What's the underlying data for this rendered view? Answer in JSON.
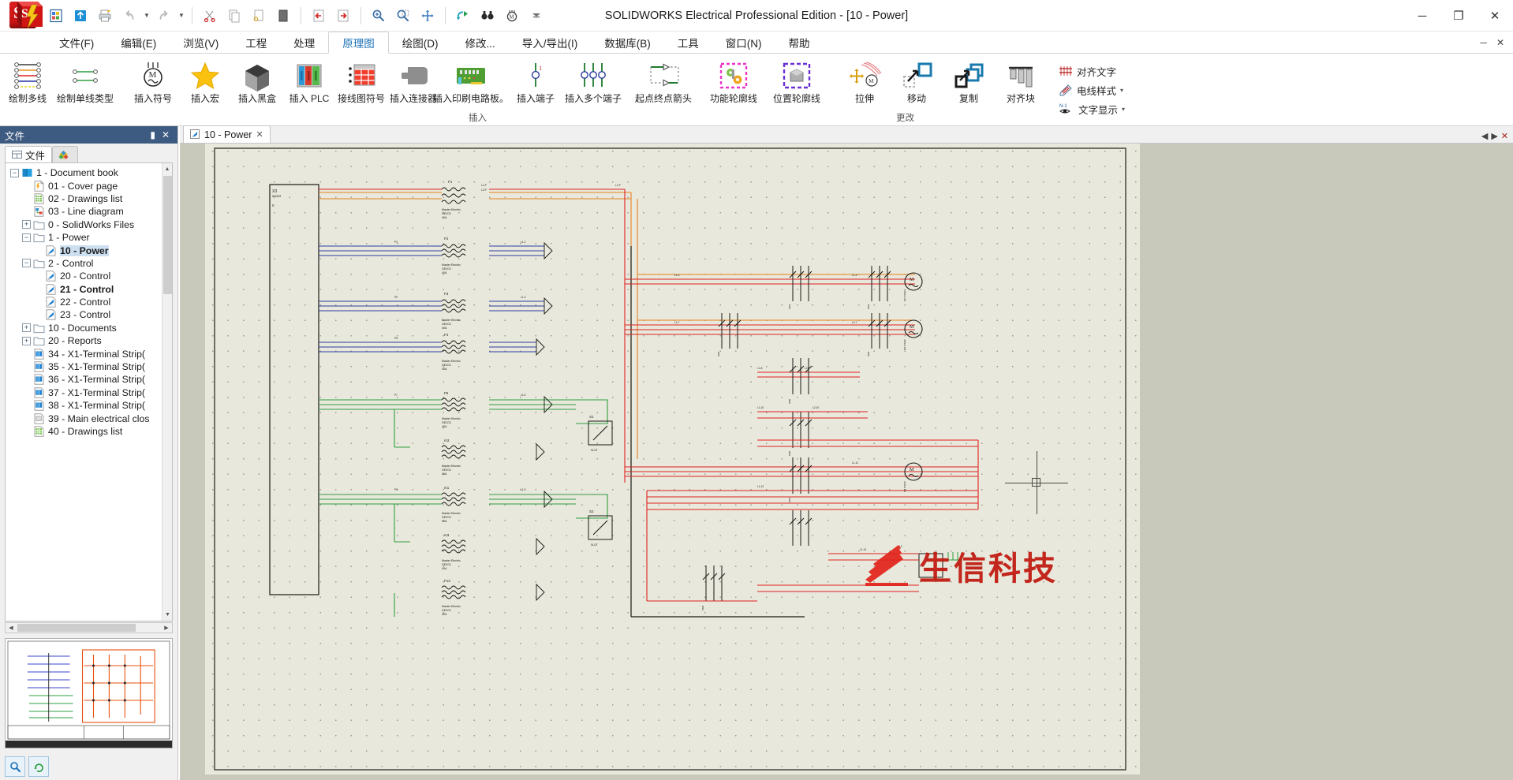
{
  "window": {
    "title": "SOLIDWORKS Electrical Professional Edition - [10 - Power]",
    "minimize_label": "─",
    "restore_label": "❐",
    "close_label": "✕"
  },
  "quick_toolbar": {
    "items": [
      {
        "name": "new-project-icon",
        "glyph": "▦"
      },
      {
        "name": "open-icon",
        "glyph": "⬆"
      },
      {
        "name": "print-icon",
        "glyph": "⎙"
      },
      {
        "name": "undo-icon",
        "glyph": "↶"
      },
      {
        "name": "undo-dropdown-icon",
        "glyph": "▾"
      },
      {
        "name": "redo-icon",
        "glyph": "↷"
      },
      {
        "name": "redo-dropdown-icon",
        "glyph": "▾"
      },
      {
        "name": "cut-icon",
        "glyph": "✂"
      },
      {
        "name": "copy-icon",
        "glyph": "❐"
      },
      {
        "name": "paste-special-icon",
        "glyph": "❑"
      },
      {
        "name": "paste-icon",
        "glyph": "▮"
      },
      {
        "name": "previous-page-icon",
        "glyph": "←"
      },
      {
        "name": "next-page-icon",
        "glyph": "→"
      },
      {
        "name": "zoom-in-icon",
        "glyph": "⌕"
      },
      {
        "name": "zoom-window-icon",
        "glyph": "⌕"
      },
      {
        "name": "pan-icon",
        "glyph": "✥"
      },
      {
        "name": "update-icon",
        "glyph": "↻"
      },
      {
        "name": "find-icon",
        "glyph": "⚭"
      },
      {
        "name": "motor-icon",
        "glyph": "Ⓜ"
      },
      {
        "name": "customize-dropdown-icon",
        "glyph": "▼"
      }
    ]
  },
  "menubar": {
    "items": [
      {
        "label": "文件(F)",
        "name": "menu-file",
        "active": false
      },
      {
        "label": "编辑(E)",
        "name": "menu-edit",
        "active": false
      },
      {
        "label": "浏览(V)",
        "name": "menu-view",
        "active": false
      },
      {
        "label": "工程",
        "name": "menu-project",
        "active": false
      },
      {
        "label": "处理",
        "name": "menu-process",
        "active": false
      },
      {
        "label": "原理图",
        "name": "menu-schematic",
        "active": true
      },
      {
        "label": "绘图(D)",
        "name": "menu-draw",
        "active": false
      },
      {
        "label": "修改...",
        "name": "menu-modify",
        "active": false
      },
      {
        "label": "导入/导出(I)",
        "name": "menu-import-export",
        "active": false
      },
      {
        "label": "数据库(B)",
        "name": "menu-database",
        "active": false
      },
      {
        "label": "工具",
        "name": "menu-tools",
        "active": false
      },
      {
        "label": "窗口(N)",
        "name": "menu-window",
        "active": false
      },
      {
        "label": "帮助",
        "name": "menu-help",
        "active": false
      }
    ],
    "minimize_ribbon": "─",
    "close_doc": "✕"
  },
  "ribbon": {
    "groups": [
      {
        "label": "",
        "name": "ribbon-group-wires",
        "buttons": [
          {
            "label": "绘制多线",
            "name": "draw-multiple-wires-button",
            "icon": "multi-wire-icon"
          },
          {
            "label": "绘制单线类型",
            "name": "draw-single-wire-type-button",
            "icon": "single-wire-icon"
          }
        ]
      },
      {
        "label": "插入",
        "name": "ribbon-group-insert",
        "buttons": [
          {
            "label": "插入符号",
            "name": "insert-symbol-button",
            "icon": "motor-symbol-icon"
          },
          {
            "label": "插入宏",
            "name": "insert-macro-button",
            "icon": "star-icon"
          },
          {
            "label": "插入黑盒",
            "name": "insert-black-box-button",
            "icon": "black-box-icon"
          },
          {
            "label": "插入 PLC",
            "name": "insert-plc-button",
            "icon": "plc-icon"
          },
          {
            "label": "接线图符号",
            "name": "wiring-diagram-symbol-button",
            "icon": "wiring-table-icon"
          },
          {
            "label": "插入连接器",
            "name": "insert-connector-button",
            "icon": "connector-icon"
          },
          {
            "label": "插入印刷电路板。",
            "name": "insert-pcb-button",
            "icon": "pcb-icon"
          },
          {
            "label": "插入端子",
            "name": "insert-terminal-button",
            "icon": "terminal-icon"
          },
          {
            "label": "插入多个端子",
            "name": "insert-multiple-terminals-button",
            "icon": "multi-terminal-icon"
          },
          {
            "label": "起点终点箭头",
            "name": "origin-destination-arrow-button",
            "icon": "arrow-link-icon"
          },
          {
            "label": "功能轮廓线",
            "name": "function-outline-button",
            "icon": "function-outline-icon"
          },
          {
            "label": "位置轮廓线",
            "name": "location-outline-button",
            "icon": "location-outline-icon"
          }
        ]
      },
      {
        "label": "更改",
        "name": "ribbon-group-modify",
        "buttons": [
          {
            "label": "拉伸",
            "name": "stretch-button",
            "icon": "stretch-icon"
          },
          {
            "label": "移动",
            "name": "move-button",
            "icon": "move-icon"
          },
          {
            "label": "复制",
            "name": "copy-button",
            "icon": "copy-block-icon"
          },
          {
            "label": "对齐块",
            "name": "align-block-button",
            "icon": "align-block-icon"
          }
        ],
        "small_buttons": [
          {
            "label": "对齐文字",
            "name": "align-text-button",
            "icon": "align-text-icon",
            "caret": false
          },
          {
            "label": "电线样式",
            "name": "wire-style-button",
            "icon": "wire-style-icon",
            "caret": true
          },
          {
            "label": "文字显示",
            "name": "text-display-button",
            "icon": "text-display-icon",
            "caret": true
          }
        ]
      }
    ]
  },
  "document_tab": {
    "label": "10 - Power",
    "icon": "schematic-icon",
    "close": "✕",
    "nav_prev": "◀",
    "nav_next": "▶",
    "nav_close": "✕"
  },
  "left_panel": {
    "title": "文件",
    "pin": "▮",
    "close": "✕",
    "tabs": [
      {
        "label": "文件",
        "name": "panel-tab-documents",
        "active": true
      },
      {
        "label": "",
        "name": "panel-tab-components",
        "active": false
      }
    ],
    "tree": [
      {
        "label": "1 - Document book",
        "name": "tree-item-document-book",
        "depth": 0,
        "expander": "minus",
        "icon": "book-icon",
        "state": "normal"
      },
      {
        "label": "01 - Cover page",
        "name": "tree-item-cover-page",
        "depth": 1,
        "expander": "none",
        "icon": "cover-icon",
        "state": "normal"
      },
      {
        "label": "02 - Drawings list",
        "name": "tree-item-drawings-list-02",
        "depth": 1,
        "expander": "none",
        "icon": "grid-doc-icon",
        "state": "normal"
      },
      {
        "label": "03 - Line diagram",
        "name": "tree-item-line-diagram",
        "depth": 1,
        "expander": "none",
        "icon": "line-doc-icon",
        "state": "normal"
      },
      {
        "label": "0 - SolidWorks Files",
        "name": "tree-item-solidworks-files",
        "depth": 1,
        "expander": "plus",
        "icon": "folder-icon",
        "state": "normal"
      },
      {
        "label": "1 - Power",
        "name": "tree-item-folder-power",
        "depth": 1,
        "expander": "minus",
        "icon": "folder-icon",
        "state": "normal"
      },
      {
        "label": "10 - Power",
        "name": "tree-item-10-power",
        "depth": 2,
        "expander": "none",
        "icon": "schema-icon",
        "state": "selected"
      },
      {
        "label": "2 - Control",
        "name": "tree-item-folder-control",
        "depth": 1,
        "expander": "minus",
        "icon": "folder-icon",
        "state": "normal"
      },
      {
        "label": "20 - Control",
        "name": "tree-item-20-control",
        "depth": 2,
        "expander": "none",
        "icon": "schema-icon",
        "state": "normal"
      },
      {
        "label": "21 - Control",
        "name": "tree-item-21-control",
        "depth": 2,
        "expander": "none",
        "icon": "schema-icon",
        "state": "bold"
      },
      {
        "label": "22 - Control",
        "name": "tree-item-22-control",
        "depth": 2,
        "expander": "none",
        "icon": "schema-icon",
        "state": "normal"
      },
      {
        "label": "23 - Control",
        "name": "tree-item-23-control",
        "depth": 2,
        "expander": "none",
        "icon": "schema-icon",
        "state": "normal"
      },
      {
        "label": "10 - Documents",
        "name": "tree-item-documents",
        "depth": 1,
        "expander": "plus",
        "icon": "folder-icon",
        "state": "normal"
      },
      {
        "label": "20 - Reports",
        "name": "tree-item-reports",
        "depth": 1,
        "expander": "plus",
        "icon": "folder-icon",
        "state": "normal"
      },
      {
        "label": "34 - X1-Terminal Strip(",
        "name": "tree-item-34-terminal-strip",
        "depth": 1,
        "expander": "none",
        "icon": "terminal-doc-icon",
        "state": "normal"
      },
      {
        "label": "35 - X1-Terminal Strip(",
        "name": "tree-item-35-terminal-strip",
        "depth": 1,
        "expander": "none",
        "icon": "terminal-doc-icon",
        "state": "normal"
      },
      {
        "label": "36 - X1-Terminal Strip(",
        "name": "tree-item-36-terminal-strip",
        "depth": 1,
        "expander": "none",
        "icon": "terminal-doc-icon",
        "state": "normal"
      },
      {
        "label": "37 - X1-Terminal Strip(",
        "name": "tree-item-37-terminal-strip",
        "depth": 1,
        "expander": "none",
        "icon": "terminal-doc-icon",
        "state": "normal"
      },
      {
        "label": "38 - X1-Terminal Strip(",
        "name": "tree-item-38-terminal-strip",
        "depth": 1,
        "expander": "none",
        "icon": "terminal-doc-icon",
        "state": "normal"
      },
      {
        "label": "39 - Main electrical clos",
        "name": "tree-item-39-main-electrical",
        "depth": 1,
        "expander": "none",
        "icon": "gray-doc-icon",
        "state": "normal"
      },
      {
        "label": "40 - Drawings list",
        "name": "tree-item-40-drawings-list",
        "depth": 1,
        "expander": "none",
        "icon": "grid-doc-icon",
        "state": "normal"
      }
    ],
    "footer_buttons": [
      {
        "name": "search-button",
        "glyph": "⌕"
      },
      {
        "name": "refresh-button",
        "glyph": "↺"
      }
    ]
  },
  "watermark": {
    "text": "生信科技",
    "color": "#c0160c"
  },
  "schematic": {
    "terminal_strip_label": "X3",
    "color_orange": "#e8821e",
    "color_red": "#e02020",
    "color_blue": "#2c3c9e",
    "color_green": "#2f9e3f",
    "color_black": "#1a1a16"
  }
}
